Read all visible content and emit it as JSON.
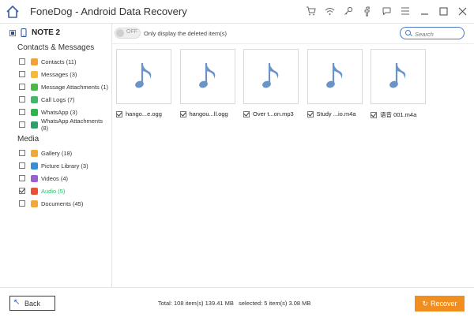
{
  "app": {
    "title": "FoneDog - Android Data Recovery"
  },
  "window_icons": [
    "cart-icon",
    "wifi-icon",
    "key-icon",
    "facebook-icon",
    "chat-icon",
    "menu-icon",
    "minimize-icon",
    "maximize-icon",
    "close-icon"
  ],
  "sidebar": {
    "device": "NOTE 2",
    "contacts_title": "Contacts & Messages",
    "contacts_items": [
      {
        "label": "Contacts (11)",
        "color": "#f2a03a",
        "checked": false
      },
      {
        "label": "Messages (3)",
        "color": "#f5b83a",
        "checked": false
      },
      {
        "label": "Message Attachments (1)",
        "color": "#4cb84c",
        "checked": false
      },
      {
        "label": "Call Logs (7)",
        "color": "#43b86a",
        "checked": false
      },
      {
        "label": "WhatsApp (3)",
        "color": "#2eb34c",
        "checked": false
      },
      {
        "label": "WhatsApp Attachments (8)",
        "color": "#2e9e6a",
        "checked": false
      }
    ],
    "media_title": "Media",
    "media_items": [
      {
        "label": "Gallery (18)",
        "color": "#f0a83a",
        "checked": false
      },
      {
        "label": "Picture Library (3)",
        "color": "#3a8fd0",
        "checked": false
      },
      {
        "label": "Videos (4)",
        "color": "#9a5fd0",
        "checked": false
      },
      {
        "label": "Audio (5)",
        "color": "#e8503a",
        "checked": true
      },
      {
        "label": "Documents (45)",
        "color": "#f0a83a",
        "checked": false
      }
    ]
  },
  "toolbar": {
    "toggle_state": "OFF",
    "toggle_label": "Only display the deleted item(s)",
    "search_placeholder": "Search"
  },
  "files": [
    {
      "name": "hango...e.ogg",
      "checked": true
    },
    {
      "name": "hangou...ll.ogg",
      "checked": true
    },
    {
      "name": "Over t...on.mp3",
      "checked": true
    },
    {
      "name": "Study ...io.m4a",
      "checked": true
    },
    {
      "name": "语音 001.m4a",
      "checked": true
    }
  ],
  "footer": {
    "back_label": "Back",
    "totals": "Total: 108 item(s) 139.41 MB   selected: 5 item(s) 3.08 MB",
    "recover_label": "Recover"
  },
  "colors": {
    "accent": "#4a78c2",
    "recover": "#f08f1f",
    "audio_active": "#2bbf6a",
    "note_icon": "#6a93c8"
  }
}
